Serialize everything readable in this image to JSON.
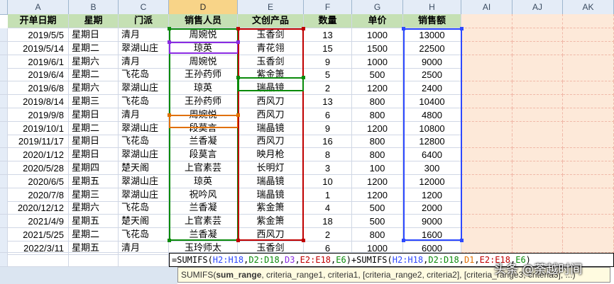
{
  "columns": [
    "A",
    "B",
    "C",
    "D",
    "E",
    "F",
    "G",
    "H",
    "AI",
    "AJ",
    "AK"
  ],
  "headers": {
    "date": "开单日期",
    "weekday": "星期",
    "school": "门派",
    "seller": "销售人员",
    "product": "文创产品",
    "qty": "数量",
    "price": "单价",
    "sales": "销售额"
  },
  "rows": [
    {
      "date": "2019/5/5",
      "weekday": "星期日",
      "school": "清月",
      "seller": "周婉悦",
      "product": "玉香剑",
      "qty": "13",
      "price": "1000",
      "sales": "13000"
    },
    {
      "date": "2019/5/14",
      "weekday": "星期二",
      "school": "翠湖山庄",
      "seller": "琼英",
      "product": "青花翎",
      "qty": "15",
      "price": "1500",
      "sales": "22500"
    },
    {
      "date": "2019/6/1",
      "weekday": "星期六",
      "school": "清月",
      "seller": "周婉悦",
      "product": "玉香剑",
      "qty": "9",
      "price": "1000",
      "sales": "9000"
    },
    {
      "date": "2019/6/4",
      "weekday": "星期二",
      "school": "飞花岛",
      "seller": "王孙药师",
      "product": "紫金箫",
      "qty": "5",
      "price": "500",
      "sales": "2500"
    },
    {
      "date": "2019/6/8",
      "weekday": "星期六",
      "school": "翠湖山庄",
      "seller": "琼英",
      "product": "瑞晶镜",
      "qty": "2",
      "price": "1200",
      "sales": "2400"
    },
    {
      "date": "2019/8/14",
      "weekday": "星期三",
      "school": "飞花岛",
      "seller": "王孙药师",
      "product": "西风刀",
      "qty": "13",
      "price": "800",
      "sales": "10400"
    },
    {
      "date": "2019/9/8",
      "weekday": "星期日",
      "school": "清月",
      "seller": "周婉悦",
      "product": "西风刀",
      "qty": "6",
      "price": "800",
      "sales": "4800"
    },
    {
      "date": "2019/10/1",
      "weekday": "星期二",
      "school": "翠湖山庄",
      "seller": "段莫言",
      "product": "瑞晶镜",
      "qty": "9",
      "price": "1200",
      "sales": "10800"
    },
    {
      "date": "2019/11/17",
      "weekday": "星期日",
      "school": "飞花岛",
      "seller": "兰香凝",
      "product": "西风刀",
      "qty": "16",
      "price": "800",
      "sales": "12800"
    },
    {
      "date": "2020/1/12",
      "weekday": "星期日",
      "school": "翠湖山庄",
      "seller": "段莫言",
      "product": "映月枪",
      "qty": "8",
      "price": "800",
      "sales": "6400"
    },
    {
      "date": "2020/5/28",
      "weekday": "星期四",
      "school": "楚天阁",
      "seller": "上官素芸",
      "product": "长明灯",
      "qty": "3",
      "price": "100",
      "sales": "300"
    },
    {
      "date": "2020/6/5",
      "weekday": "星期五",
      "school": "翠湖山庄",
      "seller": "琼英",
      "product": "瑞晶镜",
      "qty": "10",
      "price": "1200",
      "sales": "12000"
    },
    {
      "date": "2020/7/8",
      "weekday": "星期三",
      "school": "翠湖山庄",
      "seller": "祝吟风",
      "product": "瑞晶镜",
      "qty": "1",
      "price": "1200",
      "sales": "1200"
    },
    {
      "date": "2020/12/12",
      "weekday": "星期六",
      "school": "飞花岛",
      "seller": "兰香凝",
      "product": "紫金箫",
      "qty": "4",
      "price": "500",
      "sales": "2000"
    },
    {
      "date": "2021/4/9",
      "weekday": "星期五",
      "school": "楚天阁",
      "seller": "上官素芸",
      "product": "紫金箫",
      "qty": "18",
      "price": "500",
      "sales": "9000"
    },
    {
      "date": "2021/5/25",
      "weekday": "星期二",
      "school": "飞花岛",
      "seller": "兰香凝",
      "product": "西风刀",
      "qty": "2",
      "price": "800",
      "sales": "1600"
    },
    {
      "date": "2022/3/11",
      "weekday": "星期五",
      "school": "清月",
      "seller": "玉玲师太",
      "product": "玉香剑",
      "qty": "6",
      "price": "1000",
      "sales": "6000"
    }
  ],
  "formula": {
    "eq": "=SUMIFS(",
    "p1": "H2:H18",
    "c1": ",",
    "p2": "D2:D18",
    "c2": ",",
    "p3": "D3",
    "c3": ",",
    "p4": "E2:E18",
    "c4": ",",
    "p5": "E6",
    "mid": ")+SUMIFS(",
    "q1": "H2:H18",
    "c5": ",",
    "q2": "D2:D18",
    "c6": ",",
    "q3": "D1",
    "c7": ",",
    "q4": "E2:E18",
    "c8": ",",
    "q5": "E6",
    "end": ")"
  },
  "tooltip": {
    "fn": "SUMIFS(",
    "bold_arg": "sum_range",
    "rest": ", criteria_range1, criteria1, [criteria_range2, criteria2], [criteria_range3, criteria3], ...)"
  },
  "watermark": "头条 @荼越时间",
  "colors": {
    "blue": "#2d49ff",
    "green": "#0a8a0a",
    "purple": "#8a2be2",
    "red": "#c00000",
    "orange": "#e07000"
  }
}
